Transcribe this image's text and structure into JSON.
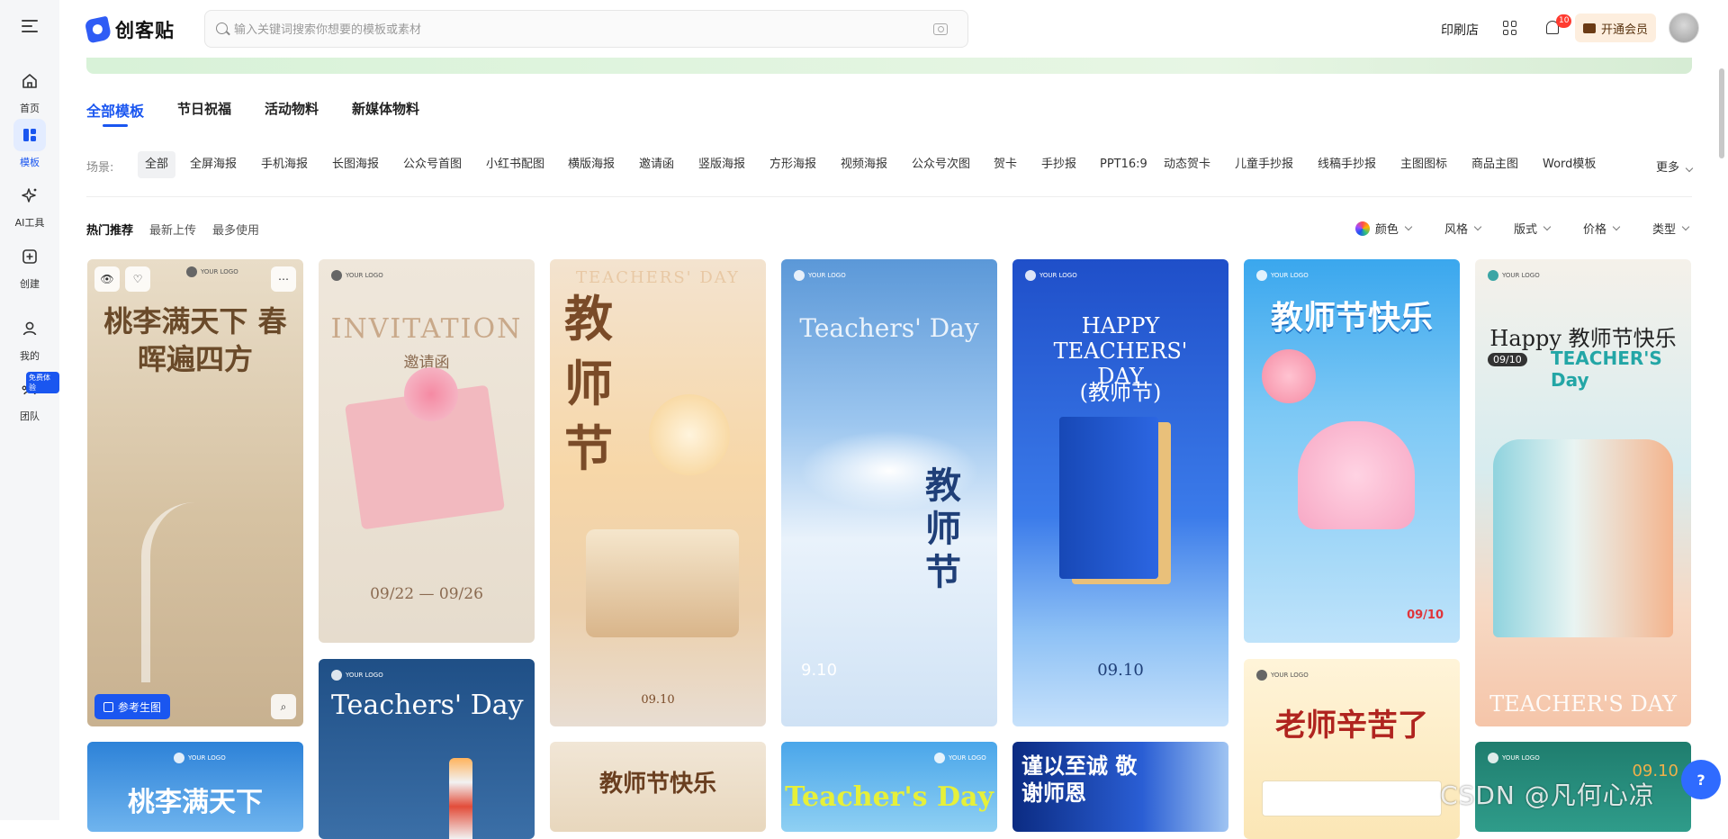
{
  "brand": {
    "name": "创客贴"
  },
  "sidebar": {
    "items": [
      {
        "label": "首页",
        "icon": "home-icon"
      },
      {
        "label": "模板",
        "icon": "template-icon"
      },
      {
        "label": "AI工具",
        "icon": "ai-sparkle-icon"
      },
      {
        "label": "创建",
        "icon": "create-plus-icon"
      },
      {
        "label": "我的",
        "icon": "user-icon"
      },
      {
        "label": "团队",
        "icon": "team-icon"
      }
    ],
    "team_badge": "免费体验"
  },
  "header": {
    "search_placeholder": "输入关键词搜索你想要的模板或素材",
    "print_shop": "印刷店",
    "notification_count": "10",
    "vip_label": "开通会员"
  },
  "tabs": [
    "全部模板",
    "节日祝福",
    "活动物料",
    "新媒体物料"
  ],
  "scene": {
    "label": "场景:",
    "chips": [
      "全部",
      "全屏海报",
      "手机海报",
      "长图海报",
      "公众号首图",
      "小红书配图",
      "横版海报",
      "邀请函",
      "竖版海报",
      "方形海报",
      "视频海报",
      "公众号次图",
      "贺卡",
      "手抄报",
      "PPT16:9",
      "动态贺卡",
      "儿童手抄报",
      "线稿手抄报",
      "主图图标",
      "商品主图",
      "Word模板"
    ],
    "more": "更多"
  },
  "sort": [
    "热门推荐",
    "最新上传",
    "最多使用"
  ],
  "filters": [
    "颜色",
    "风格",
    "版式",
    "价格",
    "类型"
  ],
  "cards": {
    "c1": {
      "logo": "YOUR LOGO",
      "title": "桃李满天下 春晖遍四方",
      "ref_button": "参考生图"
    },
    "c2": {
      "logo": "YOUR LOGO",
      "title": "INVITATION",
      "subtitle": "邀请函",
      "dates": "09/22 — 09/26"
    },
    "c3": {
      "title": "教师节",
      "eng": "TEACHERS' DAY",
      "date": "09.10"
    },
    "c4": {
      "logo": "YOUR LOGO",
      "title": "Teachers' Day",
      "cn": "教师节",
      "date": "9.10"
    },
    "c5": {
      "logo": "YOUR LOGO",
      "title": "HAPPY TEACHERS' DAY",
      "cn": "(教师节)",
      "date": "09.10"
    },
    "c6": {
      "logo": "YOUR LOGO",
      "title": "教师节快乐",
      "date": "09/10"
    },
    "c7": {
      "logo": "YOUR LOGO",
      "title": "Happy 教师节快乐",
      "eng": "TEACHER'S Day",
      "date": "09/10",
      "footer": "TEACHER'S DAY"
    },
    "c8": {
      "logo": "YOUR LOGO",
      "title": "Teachers' Day"
    },
    "c9": {
      "logo": "YOUR LOGO",
      "title": "桃李满天下"
    },
    "c10": {
      "title": "教师节快乐"
    },
    "c11": {
      "logo": "YOUR LOGO",
      "title": "Teacher's Day"
    },
    "c12": {
      "title": "谨以至诚 敬谢师恩"
    },
    "c13": {
      "logo": "YOUR LOGO",
      "title": "老师辛苦了"
    },
    "c14": {
      "logo": "YOUR LOGO",
      "date": "09.10"
    }
  },
  "watermark": "CSDN @凡何心凉",
  "colors": {
    "accent": "#1a56f0",
    "vip_bg": "#fdeede",
    "banner": "#dcf3da"
  }
}
